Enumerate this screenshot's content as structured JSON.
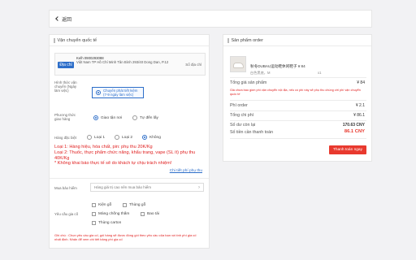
{
  "topbar": {
    "back_label": "返回"
  },
  "shipping": {
    "title": "Vận chuyển quốc tế",
    "address_tag": "Địa chỉ",
    "recipient": "Kelh 0900293088",
    "address": "Việt Nam TP Hồ Chí Minh Tân Bình 293/40 Dong Dan, P.12",
    "edit_label": "Sổ địa chỉ",
    "method_label": "Hình thức vận chuyển (Ngày làm việc)",
    "method_option": "Chuyển phát tiết kiệm",
    "method_days": "(7-9 ngày làm việc)",
    "delivery_label": "Phương thức giao hàng",
    "delivery_options": [
      "Giao tận nơi",
      "Tự đến lấy"
    ],
    "category_label": "Hàng đặc biệt",
    "category_options": [
      "Loại 1",
      "Loại 2",
      "Không"
    ],
    "notes": [
      "Loại 1: Hàng hiệu, hóa chất, pin: phụ thu 20K/Kg",
      "Loại 2: Thuốc, thực phẩm chức năng, khẩu trang, vape (SL ít) phụ thu 40K/Kg",
      "* Không khai báo thực tế sẽ do khách tự chịu trách nhiệm!"
    ],
    "fee_link": "Chi tiết phí phụ thu",
    "insurance_label": "Mua bảo hiểm",
    "insurance_placeholder": "Hàng giá trị cao nên mua bảo hiểm",
    "packing_label": "Yêu cầu gia cố",
    "packing_options": [
      "Kiện gỗ",
      "Thùng gỗ",
      "Màng chống thấm",
      "Bao tải",
      "Thùng carton"
    ],
    "footer_note": "Ghi chú : Chọn yêu cầu gia cố, gói hàng sẽ được đóng gói theo yêu cầu của bạn và tính phí gia cố nhất định. Nhấn để xem chi tiết bảng phí gia cố"
  },
  "order": {
    "title": "Sản phẩm order",
    "product_name": "秋冬DUBAU运动鞋休闲鞋子",
    "product_price": "¥ 84",
    "product_variant": "白色黑底，M",
    "product_qty": "x1",
    "subtotal_label": "Tổng giá sản phẩm",
    "subtotal_value": "¥ 84",
    "warning": "Giá chưa bao gồm phí vận chuyển nội địa, nếu có phí này sẽ phụ thu chúng với phí vận chuyển quốc tế",
    "fee_label": "Phí order",
    "fee_value": "¥ 2.1",
    "total_label": "Tổng chi phí",
    "total_value": "¥ 86.1",
    "balance_label": "Số dư còn lại",
    "balance_value": "170.63 CNY",
    "pay_label": "Số tiền cần thanh toán",
    "pay_value": "86.1 CNY",
    "pay_button": "Thanh toán ngay"
  }
}
